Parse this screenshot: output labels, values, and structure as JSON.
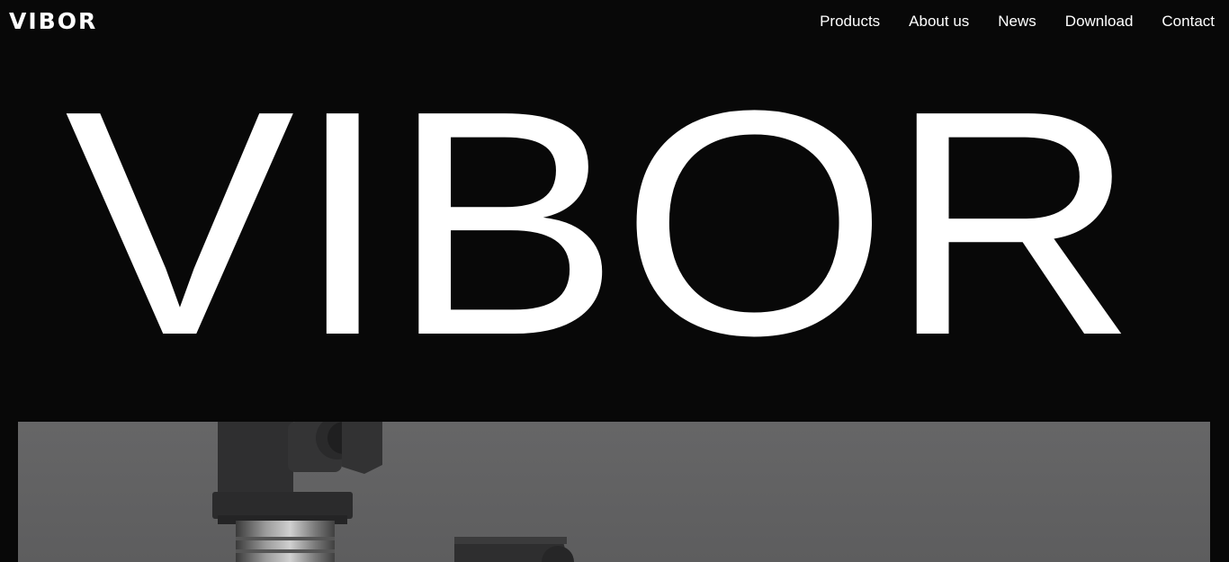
{
  "header": {
    "logo": "VIBOR",
    "nav": [
      {
        "label": "Products"
      },
      {
        "label": "About us"
      },
      {
        "label": "News"
      },
      {
        "label": "Download"
      },
      {
        "label": "Contact"
      }
    ]
  },
  "hero": {
    "title": "VIBOR",
    "image_icon": "pressure-transmitter-product-photo"
  },
  "colors": {
    "background": "#080808",
    "text": "#ffffff",
    "image_panel": "#626263"
  }
}
